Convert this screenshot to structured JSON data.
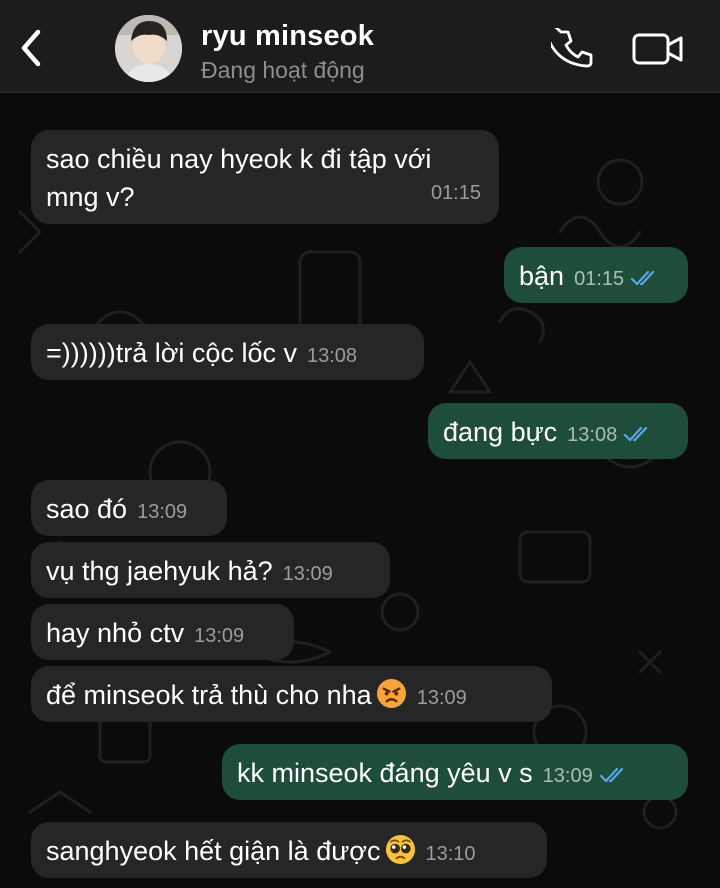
{
  "header": {
    "contact_name": "ryu minseok",
    "contact_status": "Đang hoạt động"
  },
  "messages": [
    {
      "direction": "in",
      "text": "sao chiều nay hyeok k đi tập với",
      "text2": "mng v?",
      "time": "01:15"
    },
    {
      "direction": "out",
      "text": "bận",
      "time": "01:15",
      "read": true
    },
    {
      "direction": "in",
      "text": "=))))))trả lời cộc lốc v",
      "time": "13:08"
    },
    {
      "direction": "out",
      "text": "đang bực",
      "time": "13:08",
      "read": true
    },
    {
      "direction": "in",
      "text": "sao đó",
      "time": "13:09"
    },
    {
      "direction": "in",
      "text": "vụ thg jaehyuk hả?",
      "time": "13:09"
    },
    {
      "direction": "in",
      "text": "hay nhỏ ctv",
      "time": "13:09"
    },
    {
      "direction": "in",
      "text": "để minseok trả thù cho nha",
      "emoji": "angry-face",
      "time": "13:09"
    },
    {
      "direction": "out",
      "text": "kk minseok đáng yêu v s",
      "time": "13:09",
      "read": true
    },
    {
      "direction": "in",
      "text": "sanghyeok hết giận là được",
      "emoji": "pleading-face",
      "time": "13:10"
    }
  ],
  "colors": {
    "incoming_bubble": "#262628",
    "outgoing_bubble": "#1e4d39",
    "read_ticks": "#5aa6e8",
    "header_bg": "#1c1c1d"
  }
}
